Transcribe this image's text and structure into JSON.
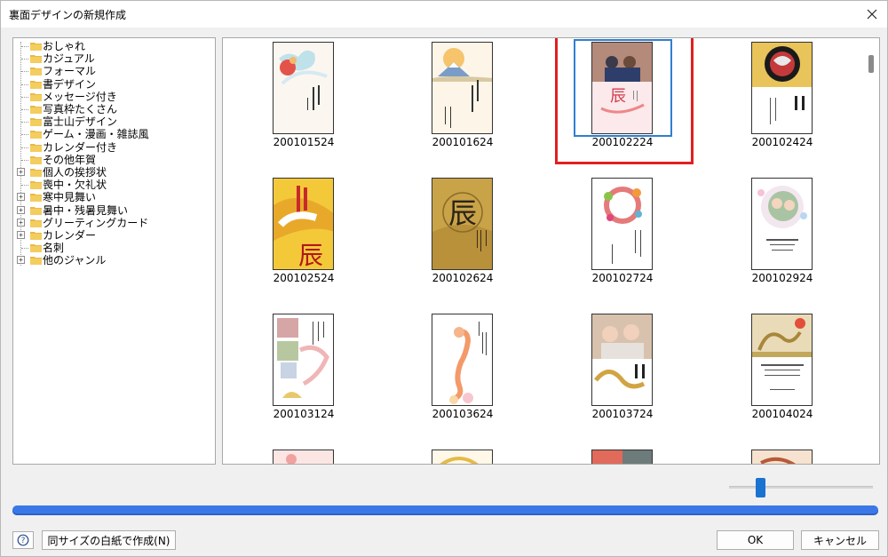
{
  "window": {
    "title": "裏面デザインの新規作成"
  },
  "tree": {
    "items": [
      {
        "label": "おしゃれ",
        "expandable": false
      },
      {
        "label": "カジュアル",
        "expandable": false
      },
      {
        "label": "フォーマル",
        "expandable": false
      },
      {
        "label": "書デザイン",
        "expandable": false
      },
      {
        "label": "メッセージ付き",
        "expandable": false
      },
      {
        "label": "写真枠たくさん",
        "expandable": false
      },
      {
        "label": "富士山デザイン",
        "expandable": false
      },
      {
        "label": "ゲーム・漫画・雑誌風",
        "expandable": false
      },
      {
        "label": "カレンダー付き",
        "expandable": false
      },
      {
        "label": "その他年賀",
        "expandable": false
      },
      {
        "label": "個人の挨拶状",
        "expandable": true
      },
      {
        "label": "喪中・欠礼状",
        "expandable": false
      },
      {
        "label": "寒中見舞い",
        "expandable": true
      },
      {
        "label": "暑中・残暑見舞い",
        "expandable": true
      },
      {
        "label": "グリーティングカード",
        "expandable": true
      },
      {
        "label": "カレンダー",
        "expandable": true
      },
      {
        "label": "名刺",
        "expandable": false
      },
      {
        "label": "他のジャンル",
        "expandable": true
      }
    ]
  },
  "templates": [
    {
      "id": "200101524",
      "selected": false
    },
    {
      "id": "200101624",
      "selected": false
    },
    {
      "id": "200102224",
      "selected": true
    },
    {
      "id": "200102424",
      "selected": false
    },
    {
      "id": "200102524",
      "selected": false
    },
    {
      "id": "200102624",
      "selected": false
    },
    {
      "id": "200102724",
      "selected": false
    },
    {
      "id": "200102924",
      "selected": false
    },
    {
      "id": "200103124",
      "selected": false
    },
    {
      "id": "200103624",
      "selected": false
    },
    {
      "id": "200103724",
      "selected": false
    },
    {
      "id": "200104024",
      "selected": false
    }
  ],
  "footer": {
    "help_icon": "?",
    "blank_button": "同サイズの白紙で作成(N)",
    "ok_button": "OK",
    "cancel_button": "キャンセル"
  },
  "colors": {
    "accent": "#1a73d0",
    "progress": "#3b78e7",
    "highlight": "#e02020",
    "selection": "#2f7fd0"
  }
}
